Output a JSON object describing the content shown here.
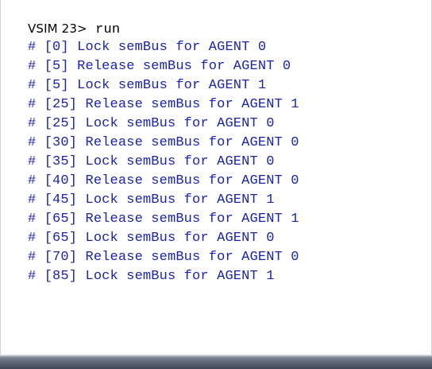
{
  "console": {
    "prompt": "VSIM 23>",
    "command": "run",
    "output_lines": [
      "# [0] Lock semBus for AGENT 0",
      "# [5] Release semBus for AGENT 0",
      "# [5] Lock semBus for AGENT 1",
      "# [25] Release semBus for AGENT 1",
      "# [25] Lock semBus for AGENT 0",
      "# [30] Release semBus for AGENT 0",
      "# [35] Lock semBus for AGENT 0",
      "# [40] Release semBus for AGENT 0",
      "# [45] Lock semBus for AGENT 1",
      "# [65] Release semBus for AGENT 1",
      "# [65] Lock semBus for AGENT 0",
      "# [70] Release semBus for AGENT 0",
      "# [85] Lock semBus for AGENT 1"
    ]
  },
  "colors": {
    "output_text": "#1c24a8",
    "prompt_text": "#000000",
    "background": "#ffffff"
  }
}
